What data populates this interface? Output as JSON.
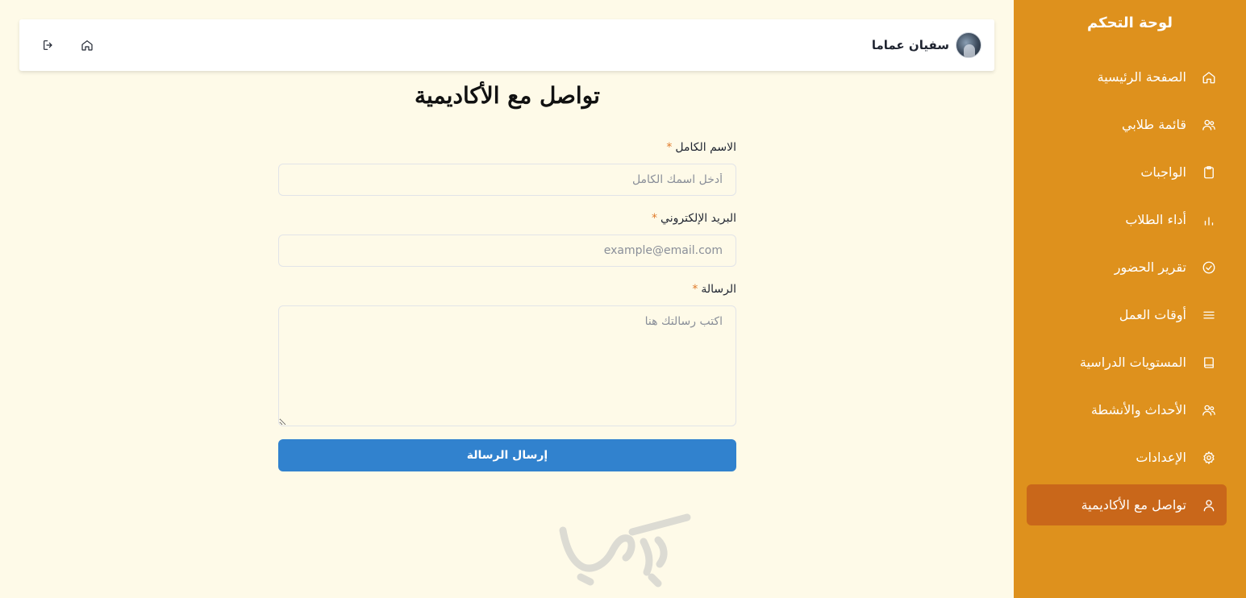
{
  "sidebar": {
    "title": "لوحة التحكم",
    "items": [
      {
        "label": "الصفحة الرئيسية",
        "icon": "home-icon"
      },
      {
        "label": "قائمة طلابي",
        "icon": "users-icon"
      },
      {
        "label": "الواجبات",
        "icon": "clipboard-icon"
      },
      {
        "label": "أداء الطلاب",
        "icon": "bar-chart-icon"
      },
      {
        "label": "تقرير الحضور",
        "icon": "check-circle-icon"
      },
      {
        "label": "أوقات العمل",
        "icon": "menu-lines-icon"
      },
      {
        "label": "المستويات الدراسية",
        "icon": "book-icon"
      },
      {
        "label": "الأحداث والأنشطة",
        "icon": "users-group-icon"
      },
      {
        "label": "الإعدادات",
        "icon": "gear-icon"
      },
      {
        "label": "تواصل مع الأكاديمية",
        "icon": "user-icon",
        "active": true
      }
    ]
  },
  "header": {
    "user_name": "سفيان عماما",
    "home_icon": "home-icon",
    "logout_icon": "logout-icon"
  },
  "form": {
    "title": "تواصل مع الأكاديمية",
    "required_mark": "*",
    "name_label": "الاسم الكامل",
    "name_placeholder": "أدخل اسمك الكامل",
    "email_label": "البريد الإلكتروني",
    "email_placeholder": "example@email.com",
    "message_label": "الرسالة",
    "message_placeholder": "اكتب رسالتك هنا",
    "submit_label": "إرسال الرسالة"
  },
  "colors": {
    "sidebar_bg": "#de911d",
    "sidebar_active": "#c9671a",
    "page_bg": "#fefae8",
    "button_bg": "#3182ce",
    "required": "#e07a2a"
  }
}
